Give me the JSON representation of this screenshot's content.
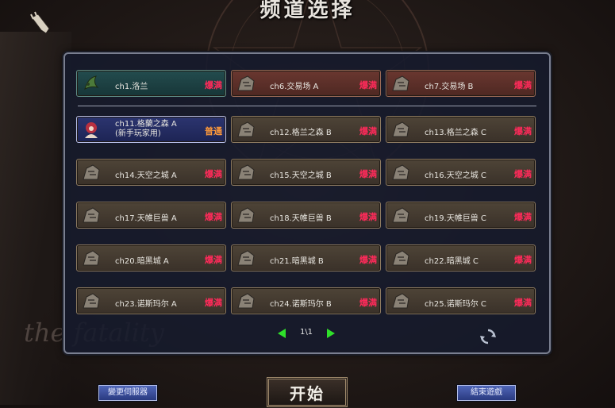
{
  "header": {
    "title": "频道选择"
  },
  "background": {
    "brand_text": "the fatality"
  },
  "channels_top": [
    {
      "label": "ch1.洛兰",
      "status": "爆满",
      "style": "teal"
    },
    {
      "label": "ch6.交易场 A",
      "status": "爆满",
      "style": "red"
    },
    {
      "label": "ch7.交易场 B",
      "status": "爆满",
      "style": "red"
    }
  ],
  "channels": [
    {
      "label": "ch11.格蘭之森 A",
      "sublabel": "(新手玩家用)",
      "status": "普通",
      "style": "sel"
    },
    {
      "label": "ch12.格兰之森 B",
      "status": "爆满",
      "style": "normal"
    },
    {
      "label": "ch13.格兰之森 C",
      "status": "爆满",
      "style": "normal"
    },
    {
      "label": "ch14.天空之城 A",
      "status": "爆满",
      "style": "normal"
    },
    {
      "label": "ch15.天空之城 B",
      "status": "爆满",
      "style": "normal"
    },
    {
      "label": "ch16.天空之城 C",
      "status": "爆满",
      "style": "normal"
    },
    {
      "label": "ch17.天帷巨兽 A",
      "status": "爆满",
      "style": "normal"
    },
    {
      "label": "ch18.天帷巨兽 B",
      "status": "爆满",
      "style": "normal"
    },
    {
      "label": "ch19.天帷巨兽 C",
      "status": "爆满",
      "style": "normal"
    },
    {
      "label": "ch20.暗黑城 A",
      "status": "爆满",
      "style": "normal"
    },
    {
      "label": "ch21.暗黑城 B",
      "status": "爆满",
      "style": "normal"
    },
    {
      "label": "ch22.暗黑城 C",
      "status": "爆满",
      "style": "normal"
    },
    {
      "label": "ch23.诺斯玛尔 A",
      "status": "爆满",
      "style": "normal"
    },
    {
      "label": "ch24.诺斯玛尔 B",
      "status": "爆满",
      "style": "normal"
    },
    {
      "label": "ch25.诺斯玛尔 C",
      "status": "爆满",
      "style": "normal"
    }
  ],
  "pager": {
    "text": "1\\1"
  },
  "footer": {
    "change_server": "變更伺服器",
    "start": "开始",
    "exit": "結束遊戲"
  },
  "colors": {
    "full_status": "#ff2a5a",
    "normal_status": "#ff9a3a",
    "arrow": "#2fe02a"
  }
}
